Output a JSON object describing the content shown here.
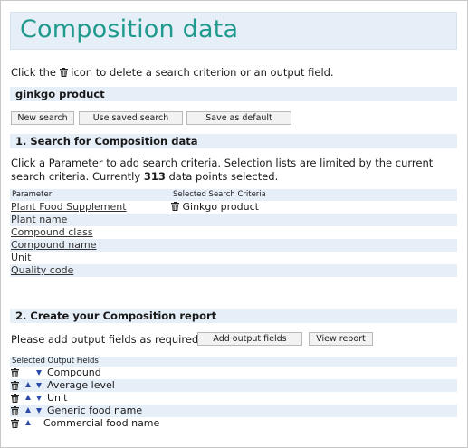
{
  "title": "Composition data",
  "instruction": {
    "before": "Click the",
    "after": "icon to delete a search criterion or an output field."
  },
  "search_name": "ginkgo product",
  "buttons": {
    "new_search": "New search",
    "use_saved_search": "Use saved search",
    "save_as_default": "Save as default",
    "add_output_fields": "Add output fields",
    "view_report": "View report"
  },
  "section1": {
    "heading": "1. Search for Composition data",
    "text_before": "Click a Parameter to add search criteria. Selection lists are limited by the current search criteria. Currently",
    "count": "313",
    "text_after": "data points selected."
  },
  "criteria_table": {
    "headers": [
      "Parameter",
      "Selected Search Criteria"
    ],
    "rows": [
      {
        "parameter": "Plant Food Supplement",
        "criteria": "Ginkgo product"
      },
      {
        "parameter": "Plant name",
        "criteria": ""
      },
      {
        "parameter": "Compound class",
        "criteria": ""
      },
      {
        "parameter": "Compound name",
        "criteria": ""
      },
      {
        "parameter": "Unit",
        "criteria": ""
      },
      {
        "parameter": "Quality code",
        "criteria": ""
      }
    ]
  },
  "section2": {
    "heading": "2. Create your Composition report",
    "instruction": "Please add output fields as required:"
  },
  "output_fields": {
    "header": "Selected Output Fields",
    "items": [
      "Compound",
      "Average level",
      "Unit",
      "Generic food name",
      "Commercial food name"
    ]
  },
  "icons": {
    "trash": "trash-icon",
    "up": "arrow-up-icon",
    "down": "arrow-down-icon"
  },
  "colors": {
    "title": "#1f9a8c",
    "band": "#e6eef8",
    "arrow": "#2b4aa8"
  }
}
